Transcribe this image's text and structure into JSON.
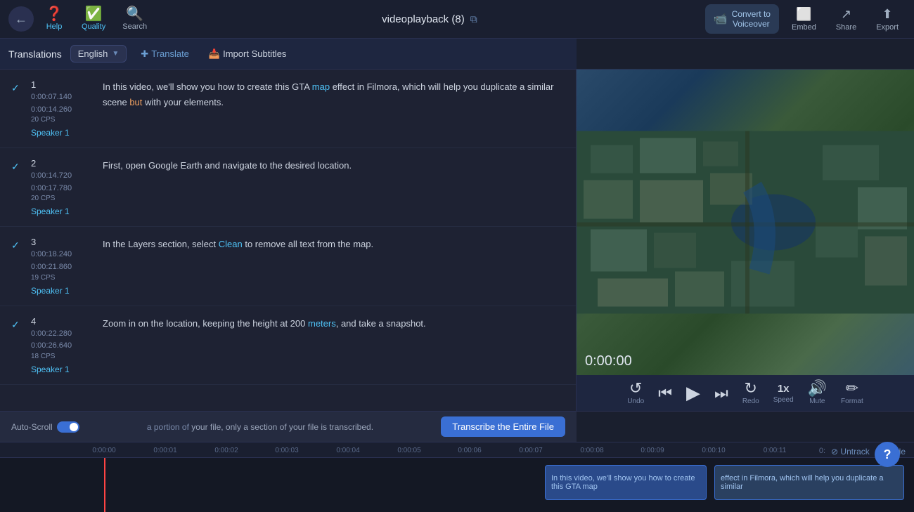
{
  "toolbar": {
    "back_icon": "←",
    "help_label": "Help",
    "quality_label": "Quality",
    "search_label": "Search",
    "title": "videoplayback (8)",
    "ext_link_icon": "⧉",
    "convert_label": "Convert to\nVoiceover",
    "embed_label": "Embed",
    "share_label": "Share",
    "export_label": "Export"
  },
  "subtitle_header": {
    "translations_label": "Translations",
    "language": "English",
    "translate_icon": "+",
    "translate_label": "Translate",
    "import_icon": "⬇",
    "import_label": "Import Subtitles"
  },
  "subtitles": [
    {
      "id": 1,
      "num": "1",
      "time_start": "0:00:07.140",
      "time_end": "0:00:14.260",
      "cps": "20 CPS",
      "speaker": "Speaker 1",
      "text_parts": [
        {
          "text": "In this video, we'll show you how to create this GTA ",
          "type": "normal"
        },
        {
          "text": "map",
          "type": "blue"
        },
        {
          "text": " effect in Filmora, which will help you duplicate a similar scene ",
          "type": "normal"
        },
        {
          "text": "but",
          "type": "orange"
        },
        {
          "text": " with your elements.",
          "type": "normal"
        }
      ]
    },
    {
      "id": 2,
      "num": "2",
      "time_start": "0:00:14.720",
      "time_end": "0:00:17.780",
      "cps": "20 CPS",
      "speaker": "Speaker 1",
      "text_plain": "First, open Google Earth and navigate to the desired location."
    },
    {
      "id": 3,
      "num": "3",
      "time_start": "0:00:18.240",
      "time_end": "0:00:21.860",
      "cps": "19 CPS",
      "speaker": "Speaker 1",
      "text_parts": [
        {
          "text": "In the Layers section, select ",
          "type": "normal"
        },
        {
          "text": "Clean",
          "type": "blue"
        },
        {
          "text": " to remove all text from the map.",
          "type": "normal"
        }
      ]
    },
    {
      "id": 4,
      "num": "4",
      "time_start": "0:00:22.280",
      "time_end": "0:00:26.640",
      "cps": "18 CPS",
      "speaker": "Speaker 1",
      "text_parts": [
        {
          "text": "Zoom in on the location, keeping the height at 200 ",
          "type": "normal"
        },
        {
          "text": "meters",
          "type": "blue"
        },
        {
          "text": ", and take a snapshot.",
          "type": "normal"
        }
      ]
    }
  ],
  "notification": {
    "text": "a portion of your file, only a section of your file is transcribed.",
    "button_label": "Transcribe the Entire File"
  },
  "auto_scroll": {
    "label": "Auto-Scroll"
  },
  "video": {
    "time": "0:00:00"
  },
  "controls": {
    "undo_label": "Undo",
    "redo_label": "Redo",
    "speed_label": "Speed",
    "speed_value": "1x",
    "mute_label": "Mute",
    "format_label": "Format"
  },
  "timeline": {
    "markers": [
      "0:00:00",
      "0:00:01",
      "0:00:02",
      "0:00:03",
      "0:00:04",
      "0:00:05",
      "0:00:06",
      "0:00:07",
      "0:00:08",
      "0:00:09",
      "0:00:10",
      "0:00:11"
    ],
    "untrack_label": "Untrack",
    "hide_label": "Hide",
    "clip_text_1": "In this video, we'll show you how to create this GTA map",
    "clip_text_2": "effect in Filmora, which will help you duplicate a similar"
  }
}
